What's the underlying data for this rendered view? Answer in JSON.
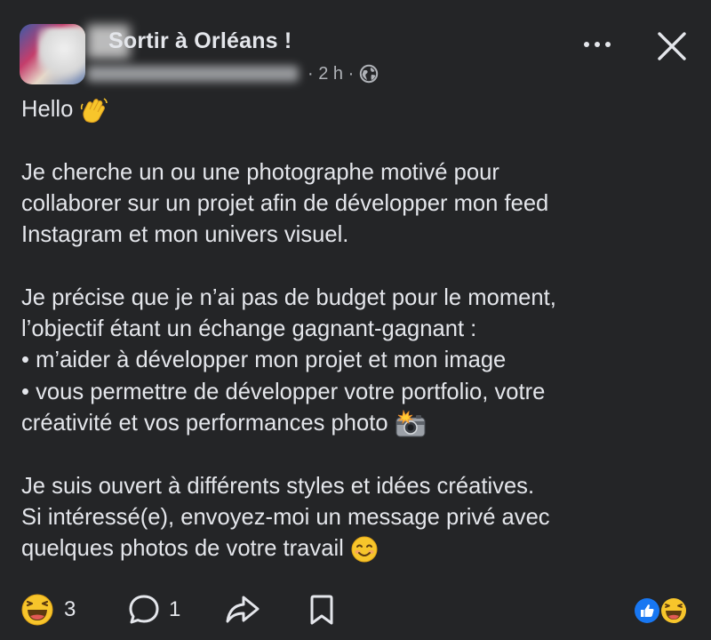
{
  "post": {
    "group_name": "Sortir à Orléans !",
    "meta": "· 2 h ·",
    "visibility_icon": "globe-icon",
    "paragraphs": [
      {
        "lines": [
          "Hello"
        ],
        "emoji": "waving-hand-icon"
      },
      {
        "lines": [
          "Je cherche un ou une photographe motivé pour",
          "collaborer sur un projet afin de développer mon feed",
          "Instagram et mon univers visuel."
        ]
      },
      {
        "lines": [
          "Je précise que je n’ai pas de budget pour le moment,",
          "l’objectif étant un échange gagnant-gagnant :",
          "• m’aider à développer mon projet et mon image",
          "• vous permettre de développer votre portfolio, votre",
          "créativité et vos performances photo"
        ],
        "emoji": "camera-flash-icon"
      },
      {
        "lines": [
          "Je suis ouvert à différents styles et idées créatives.",
          "Si intéressé(e), envoyez-moi un message privé avec",
          "quelques photos de votre travail"
        ],
        "emoji": "smiling-face-icon"
      }
    ]
  },
  "actions": {
    "reaction_count": "3",
    "comment_count": "1"
  },
  "colors": {
    "background": "#242527",
    "text": "#e4e6eb",
    "secondary_text": "#b0b3b8",
    "like_blue": "#1877f2",
    "emoji_yellow": "#f7c52b"
  }
}
